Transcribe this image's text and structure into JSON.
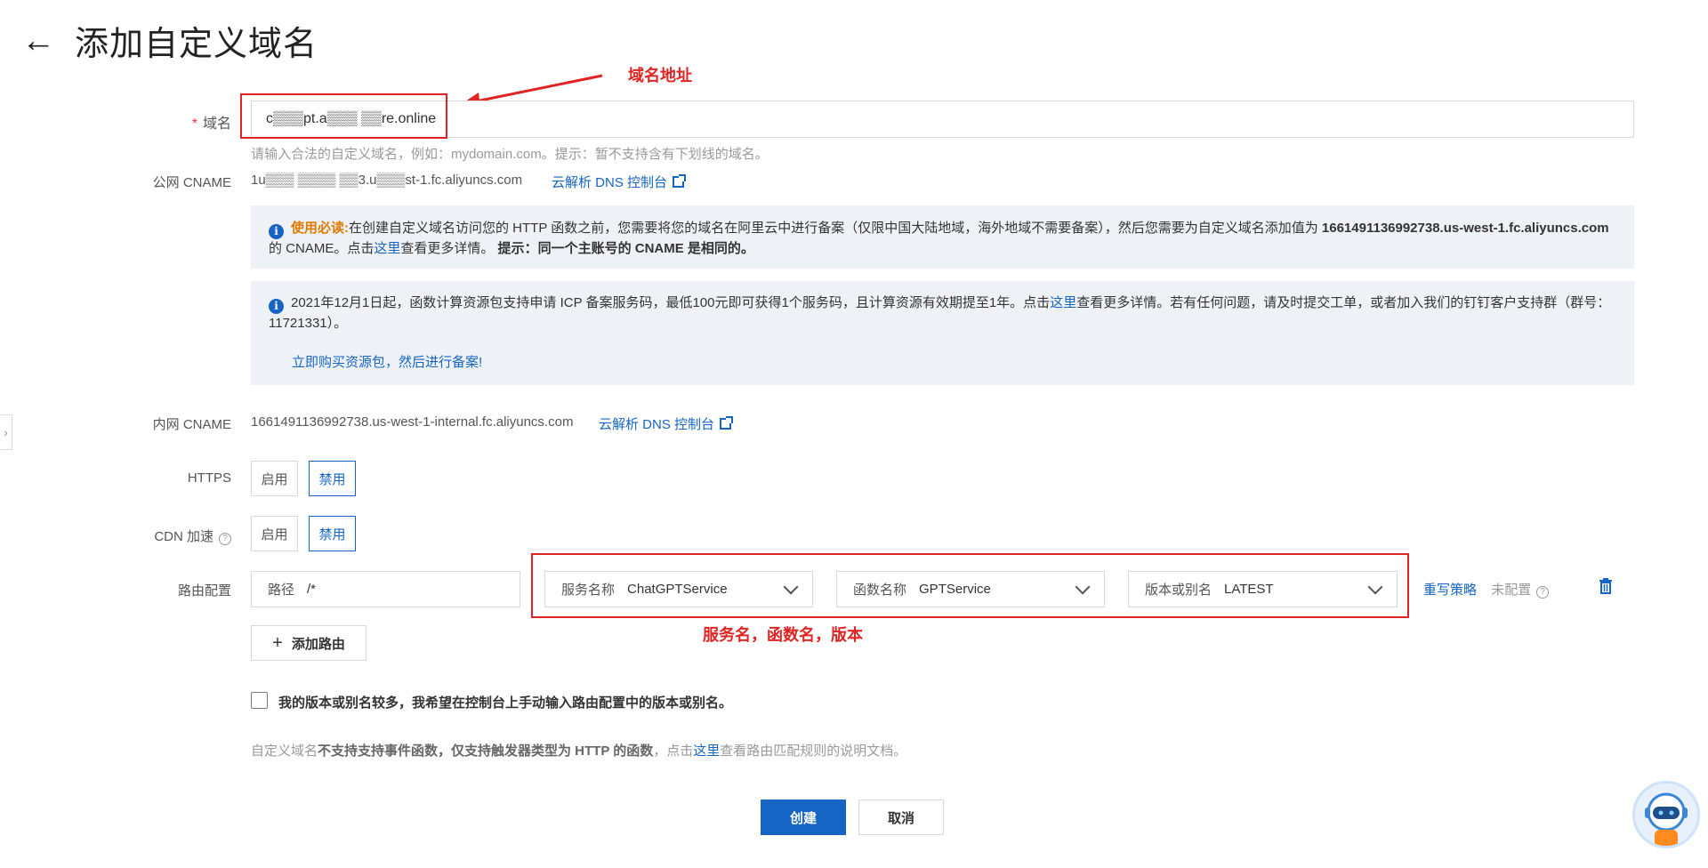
{
  "page": {
    "title": "添加自定义域名",
    "back_icon": "arrow-left-icon"
  },
  "annotations": {
    "domain_address": "域名地址",
    "service_function_version": "服务名，函数名，版本"
  },
  "domain": {
    "label": "域名",
    "required_mark": "*",
    "value": "c▒▒▒pt.a▒▒▒ ▒▒re.online",
    "hint": "请输入合法的自定义域名，例如：mydomain.com。提示：暂不支持含有下划线的域名。"
  },
  "public_cname": {
    "label": "公网 CNAME",
    "value": "1u▒▒▒ ▒▒▒▒ ▒▒3.u▒▒▒st-1.fc.aliyuncs.com",
    "dns_link": "云解析 DNS 控制台"
  },
  "notice1": {
    "prefix": "使用必读:",
    "text1": "在创建自定义域名访问您的 HTTP 函数之前，您需要将您的域名在阿里云中进行备案（仅限中国大陆地域，海外地域不需要备案），然后您需要为自定义域名添加值为",
    "cname_value": "1661491136992738.us-west-1.fc.aliyuncs.com",
    "text2": "的 CNAME。点击",
    "link": "这里",
    "text3": "查看更多详情。",
    "tip_label": "提示：",
    "tip_text": "同一个主账号的 CNAME 是相同的。"
  },
  "notice2": {
    "text1": "2021年12月1日起，函数计算资源包支持申请 ICP 备案服务码，最低100元即可获得1个服务码，且计算资源有效期提至1年。点击",
    "link": "这里",
    "text2": "查看更多详情。若有任何问题，请及时提交工单，或者加入我们的钉钉客户支持群（群号：11721331）。",
    "buy_link": "立即购买资源包，然后进行备案!"
  },
  "internal_cname": {
    "label": "内网 CNAME",
    "value": "1661491136992738.us-west-1-internal.fc.aliyuncs.com",
    "dns_link": "云解析 DNS 控制台"
  },
  "https": {
    "label": "HTTPS",
    "enable": "启用",
    "disable": "禁用"
  },
  "cdn": {
    "label": "CDN 加速",
    "enable": "启用",
    "disable": "禁用"
  },
  "route": {
    "label": "路由配置",
    "path_key": "路径",
    "path_value": "/*",
    "service_key": "服务名称",
    "service_value": "ChatGPTService",
    "function_key": "函数名称",
    "function_value": "GPTService",
    "version_key": "版本或别名",
    "version_value": "LATEST",
    "rewrite_link": "重写策略",
    "rewrite_status": "未配置",
    "add_route": "添加路由"
  },
  "manual_version": {
    "text": "我的版本或别名较多，我希望在控制台上手动输入路由配置中的版本或别名。"
  },
  "footer_note": {
    "t1": "自定义域名",
    "t2": "不支持支持事件函数，仅支持触发器类型为 HTTP 的函数",
    "t3": "，点击",
    "link": "这里",
    "t4": "查看路由匹配规则的说明文档。"
  },
  "actions": {
    "create": "创建",
    "cancel": "取消"
  },
  "colors": {
    "primary": "#1665c4",
    "annotation_red": "#e02424",
    "notice_bg": "#eef2f7",
    "warning": "#e07a00"
  }
}
